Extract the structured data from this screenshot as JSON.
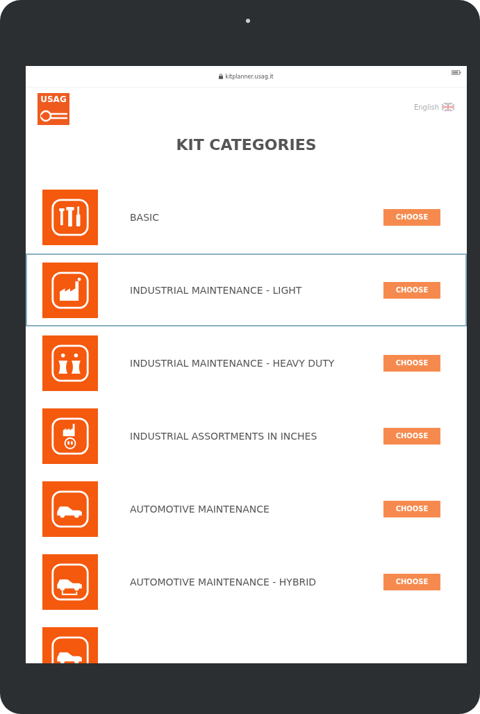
{
  "browser": {
    "address": "kitplanner.usag.it"
  },
  "header": {
    "logo": "USAG",
    "language": "English"
  },
  "title": "KIT CATEGORIES",
  "categories": [
    {
      "kind": "tools",
      "label": "BASIC",
      "button": "CHOOSE",
      "selected": false
    },
    {
      "kind": "factory",
      "label": "INDUSTRIAL MAINTENANCE - LIGHT",
      "button": "CHOOSE",
      "selected": true
    },
    {
      "kind": "towers",
      "label": "INDUSTRIAL MAINTENANCE - HEAVY DUTY",
      "button": "CHOOSE",
      "selected": false
    },
    {
      "kind": "inches",
      "label": "INDUSTRIAL ASSORTMENTS IN INCHES",
      "button": "CHOOSE",
      "selected": false
    },
    {
      "kind": "car",
      "label": "AUTOMOTIVE MAINTENANCE",
      "button": "CHOOSE",
      "selected": false
    },
    {
      "kind": "hybrid",
      "label": "AUTOMOTIVE MAINTENANCE - HYBRID",
      "button": "CHOOSE",
      "selected": false
    },
    {
      "kind": "car",
      "selected": false
    }
  ]
}
